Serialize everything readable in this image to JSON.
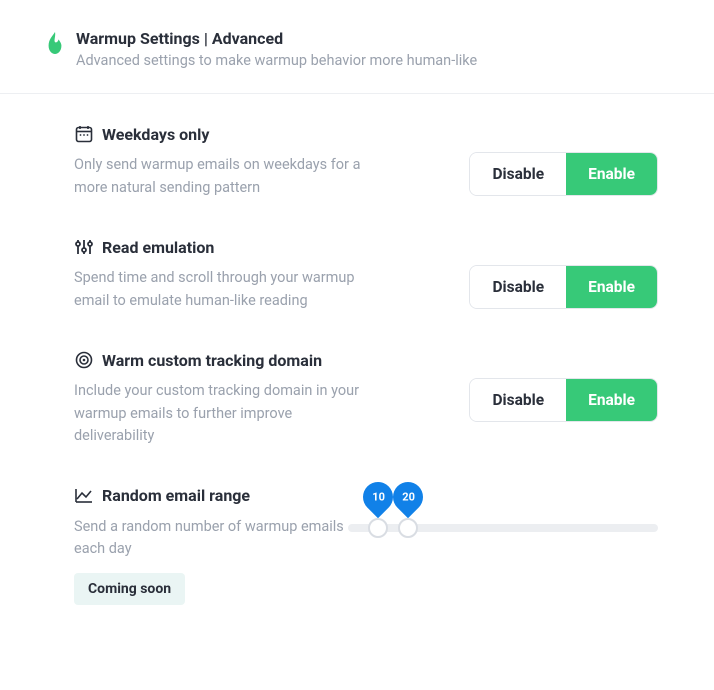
{
  "header": {
    "title": "Warmup Settings | Advanced",
    "subtitle": "Advanced settings to make warmup behavior more human-like"
  },
  "toggle": {
    "disable": "Disable",
    "enable": "Enable"
  },
  "settings": {
    "weekdays": {
      "title": "Weekdays only",
      "desc": "Only send warmup emails on weekdays for a more natural sending pattern"
    },
    "read": {
      "title": "Read emulation",
      "desc": "Spend time and scroll through your warmup email to emulate human-like reading"
    },
    "tracking": {
      "title": "Warm custom tracking domain",
      "desc": "Include your custom tracking domain in your warmup emails to further improve deliverability"
    },
    "range": {
      "title": "Random email range",
      "desc": "Send a random number of warmup emails each day",
      "badge": "Coming soon",
      "min": "10",
      "max": "20"
    }
  }
}
